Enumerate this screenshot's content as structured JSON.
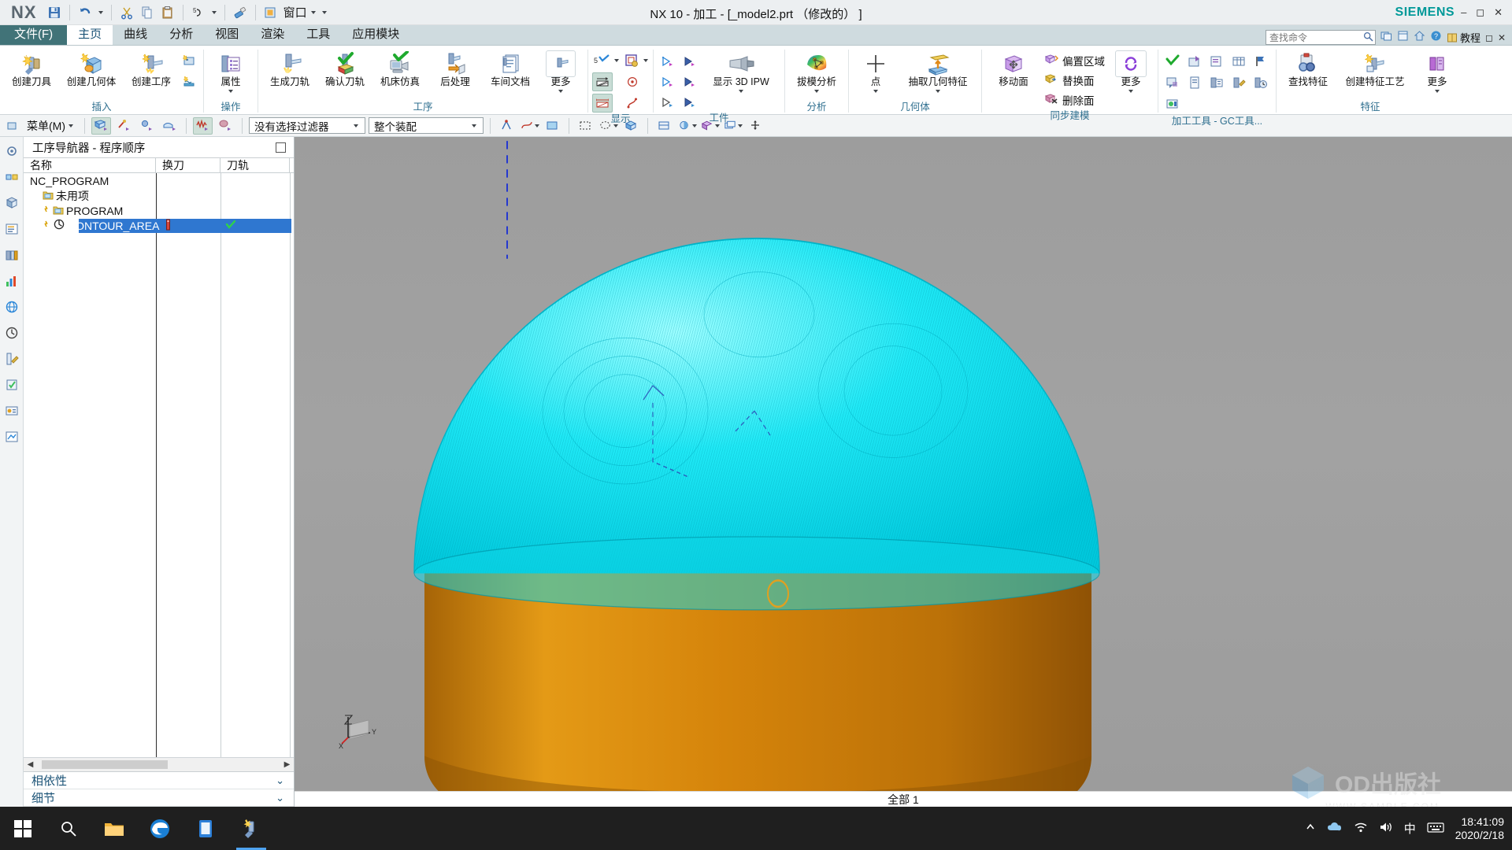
{
  "titlebar": {
    "logo": "NX",
    "title": "NX 10 - 加工 - [_model2.prt  （修改的）  ]",
    "brand": "SIEMENS",
    "window_label": "窗口",
    "qat": [
      {
        "name": "save-icon",
        "label": "保存"
      },
      {
        "name": "undo-icon",
        "label": "撤销"
      },
      {
        "name": "cut-icon",
        "label": "剪切"
      },
      {
        "name": "copy-icon",
        "label": "复制"
      },
      {
        "name": "paste-icon",
        "label": "粘贴"
      },
      {
        "name": "layer-icon",
        "label": "图层"
      },
      {
        "name": "eraser-icon",
        "label": "擦除"
      },
      {
        "name": "window-icon",
        "label": "窗口"
      }
    ],
    "controls": [
      "最小化",
      "最大化",
      "关闭"
    ]
  },
  "search": {
    "placeholder": "查找命令",
    "value": ""
  },
  "help_bar": {
    "items": [
      "switch-window-icon",
      "window-icon",
      "home-icon",
      "help-icon"
    ],
    "tutorial_label": "教程"
  },
  "tabs": [
    {
      "label": "文件(F)",
      "kind": "file"
    },
    {
      "label": "主页",
      "kind": "active"
    },
    {
      "label": "曲线",
      "kind": "normal"
    },
    {
      "label": "分析",
      "kind": "normal"
    },
    {
      "label": "视图",
      "kind": "normal"
    },
    {
      "label": "渲染",
      "kind": "normal"
    },
    {
      "label": "工具",
      "kind": "normal"
    },
    {
      "label": "应用模块",
      "kind": "normal"
    }
  ],
  "ribbon": {
    "groups": [
      {
        "label": "插入",
        "buttons": [
          {
            "label": "创建刀具",
            "icon": "create-tool-icon"
          },
          {
            "label": "创建几何体",
            "icon": "create-geometry-icon"
          },
          {
            "label": "创建工序",
            "icon": "create-operation-icon"
          }
        ],
        "small": [
          {
            "icon": "create-program-icon",
            "label": "创建程序"
          },
          {
            "icon": "create-method-icon",
            "label": "创建方法"
          }
        ]
      },
      {
        "label": "操作",
        "buttons": [
          {
            "label": "属性",
            "icon": "properties-icon",
            "dropdown": true
          }
        ]
      },
      {
        "label": "工序",
        "buttons": [
          {
            "label": "生成刀轨",
            "icon": "generate-toolpath-icon"
          },
          {
            "label": "确认刀轨",
            "icon": "verify-toolpath-icon"
          },
          {
            "label": "机床仿真",
            "icon": "machine-sim-icon"
          },
          {
            "label": "后处理",
            "icon": "postprocess-icon"
          },
          {
            "label": "车间文档",
            "icon": "shop-doc-icon"
          },
          {
            "label": "更多",
            "icon": "more-icon",
            "dropdown": true
          }
        ]
      },
      {
        "label": "显示",
        "small": [
          {
            "icon": "display-toolpath-icon",
            "label": "显示刀轨"
          },
          {
            "icon": "toolpath-color-icon",
            "label": "刀轨颜色"
          },
          {
            "icon": "trim-start-icon",
            "label": "修剪起点"
          },
          {
            "icon": "trim-end-icon",
            "label": "修剪终点"
          },
          {
            "icon": "point-marker-icon",
            "label": "点标记"
          },
          {
            "icon": "curve-icon",
            "label": "曲线"
          }
        ]
      },
      {
        "label": "工件",
        "buttons": [
          {
            "label": "显示 3D IPW",
            "icon": "ipw-icon",
            "dropdown": true
          }
        ],
        "small": [
          {
            "icon": "play-step-1-icon",
            "label": "步进1"
          },
          {
            "icon": "play-step-2-icon",
            "label": "步进2"
          },
          {
            "icon": "play-step-3-icon",
            "label": "步进3"
          },
          {
            "icon": "play-step-4-icon",
            "label": "步进4"
          },
          {
            "icon": "play-step-5-icon",
            "label": "步进5"
          },
          {
            "icon": "play-step-6-icon",
            "label": "步进6"
          }
        ]
      },
      {
        "label": "分析",
        "buttons": [
          {
            "label": "拔模分析",
            "icon": "draft-analysis-icon",
            "dropdown": true
          }
        ]
      },
      {
        "label": "几何体",
        "buttons": [
          {
            "label": "点",
            "icon": "point-icon",
            "dropdown": true
          },
          {
            "label": "抽取几何特征",
            "icon": "extract-geometry-icon",
            "dropdown": true
          }
        ]
      },
      {
        "label": "同步建模",
        "buttons": [
          {
            "label": "移动面",
            "icon": "move-face-icon"
          },
          {
            "label": "更多",
            "icon": "sync-more-icon",
            "dropdown": true
          }
        ],
        "textcmds": [
          {
            "label": "偏置区域",
            "icon": "offset-region-icon"
          },
          {
            "label": "替换面",
            "icon": "replace-face-icon"
          },
          {
            "label": "删除面",
            "icon": "delete-face-icon"
          }
        ]
      },
      {
        "label": "加工工具 - GC工具...",
        "small": [
          {
            "icon": "check-tool-icon",
            "label": "检查"
          },
          {
            "icon": "tool-db-icon",
            "label": "刀具库"
          },
          {
            "icon": "report-icon",
            "label": "报告"
          },
          {
            "icon": "table-icon",
            "label": "表格"
          },
          {
            "icon": "flag-icon",
            "label": "标记"
          },
          {
            "icon": "note-icon",
            "label": "注释"
          },
          {
            "icon": "doc-icon",
            "label": "文档"
          },
          {
            "icon": "list-icon",
            "label": "列表"
          },
          {
            "icon": "wrench-icon",
            "label": "工具"
          },
          {
            "icon": "clock-icon",
            "label": "时间"
          },
          {
            "icon": "export-icon",
            "label": "导出"
          }
        ]
      },
      {
        "label": "特征",
        "buttons": [
          {
            "label": "查找特征",
            "icon": "find-feature-icon"
          },
          {
            "label": "创建特征工艺",
            "icon": "create-feature-process-icon"
          },
          {
            "label": "更多",
            "icon": "feature-more-icon",
            "dropdown": true
          }
        ]
      }
    ]
  },
  "selectionbar": {
    "menu_label": "菜单(M)",
    "filter_combo": {
      "value": "没有选择过滤器"
    },
    "scope_combo": {
      "value": "整个装配"
    },
    "icons": [
      {
        "name": "select-face-icon",
        "selected": true
      },
      {
        "name": "select-edge-icon",
        "selected": false
      },
      {
        "name": "select-point-icon",
        "selected": false
      },
      {
        "name": "select-body-icon",
        "selected": false
      },
      {
        "name": "select-toolpath-icon",
        "selected": true
      },
      {
        "name": "select-feature-icon",
        "selected": false
      },
      {
        "name": "snap-point-icon",
        "selected": false
      },
      {
        "name": "curve-rule-icon",
        "selected": false
      },
      {
        "name": "face-rule-icon",
        "selected": false
      },
      {
        "name": "stop-at-icon",
        "selected": false
      },
      {
        "name": "rectangle-select-icon",
        "selected": false
      },
      {
        "name": "lasso-select-icon",
        "selected": false
      },
      {
        "name": "solid-select-icon",
        "selected": false
      },
      {
        "name": "display-mode-icon",
        "selected": false
      },
      {
        "name": "render-style-icon",
        "selected": false
      },
      {
        "name": "orient-view-icon",
        "selected": false
      },
      {
        "name": "layer-visible-icon",
        "selected": false
      },
      {
        "name": "move-object-icon",
        "selected": false
      }
    ]
  },
  "resource_bar": [
    {
      "name": "assembly-navigator-icon"
    },
    {
      "name": "constraint-navigator-icon"
    },
    {
      "name": "part-navigator-icon"
    },
    {
      "name": "operation-navigator-icon"
    },
    {
      "name": "reuse-library-icon"
    },
    {
      "name": "hd3d-icon"
    },
    {
      "name": "web-browser-icon"
    },
    {
      "name": "history-icon"
    },
    {
      "name": "process-studio-icon"
    },
    {
      "name": "manufacturing-wizard-icon"
    },
    {
      "name": "roles-icon"
    },
    {
      "name": "system-scene-icon"
    }
  ],
  "navigator": {
    "title": "工序导航器 - 程序顺序",
    "pin_name": "pin-panel-button",
    "columns": [
      "名称",
      "换刀",
      "刀轨"
    ],
    "rows": [
      {
        "label": "NC_PROGRAM",
        "indent": 0,
        "icon": "none",
        "selected": false,
        "tool_change": "",
        "toolpath": ""
      },
      {
        "label": "未用项",
        "indent": 1,
        "icon": "folder-icon",
        "selected": false,
        "tool_change": "",
        "toolpath": ""
      },
      {
        "label": "PROGRAM",
        "indent": 1,
        "icon": "folder-icon",
        "selected": false,
        "tool_change": "",
        "toolpath": ""
      },
      {
        "label": "CONTOUR_AREA",
        "indent": 2,
        "icon": "operation-icon",
        "selected": true,
        "tool_change": "tool-change-icon",
        "toolpath": "check-icon"
      }
    ],
    "hscrollbar_name": "navigator-hscrollbar",
    "accordion": [
      {
        "label": "相依性",
        "chevron": "⌄"
      },
      {
        "label": "细节",
        "chevron": "⌄"
      }
    ]
  },
  "viewport": {
    "status_text": "全部 1",
    "triad": {
      "x": "X",
      "y": "Y",
      "z": "Z"
    },
    "colors": {
      "background_top": "#9d9d9d",
      "background_bottom": "#9c9c9c",
      "toolpath_cyan": "#00e5f0",
      "stock_orange": "#d4820a",
      "stock_orange_dark": "#b06a05",
      "axis_blue": "#2030d0"
    }
  },
  "watermark": {
    "text": "OD出版社",
    "sub": "WWW.SAMPLE.COM"
  },
  "taskbar": {
    "start_name": "start-button",
    "items": [
      {
        "name": "search-icon"
      },
      {
        "name": "file-explorer-icon"
      },
      {
        "name": "edge-browser-icon"
      },
      {
        "name": "store-icon"
      },
      {
        "name": "nx-taskbar-icon",
        "active": true
      }
    ],
    "tray": [
      {
        "name": "show-hidden-icons-chevron"
      },
      {
        "name": "onedrive-icon"
      },
      {
        "name": "network-icon"
      },
      {
        "name": "volume-icon"
      },
      {
        "name": "ime-icon",
        "label": "中"
      },
      {
        "name": "keyboard-icon"
      }
    ],
    "clock_time": "18:41:09",
    "clock_date": "2020/2/18"
  }
}
